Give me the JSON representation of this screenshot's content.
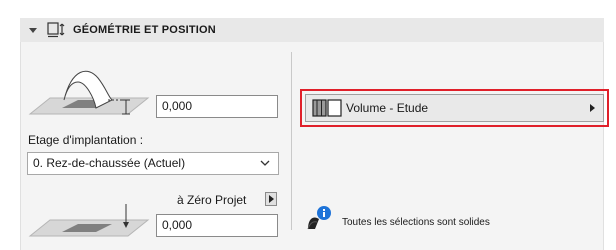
{
  "section": {
    "title": "GÉOMÉTRIE ET POSITION",
    "toggle_icon": "triangle-down-icon",
    "icon": "geometry-position-icon"
  },
  "top_offset": {
    "value": "0,000",
    "illustration": "top-offset-illustration"
  },
  "story": {
    "label": "Etage d'implantation :",
    "selected": "0. Rez-de-chaussée (Actuel)"
  },
  "reference": {
    "label": "à Zéro Projet",
    "value": "0,000",
    "illustration": "bottom-elevation-illustration"
  },
  "volume": {
    "label": "Volume - Etude",
    "icon": "volume-study-icon",
    "highlight_color": "#e0202a"
  },
  "solid_status": {
    "text": "Toutes les sélections sont solides",
    "icon": "solid-info-icon"
  }
}
